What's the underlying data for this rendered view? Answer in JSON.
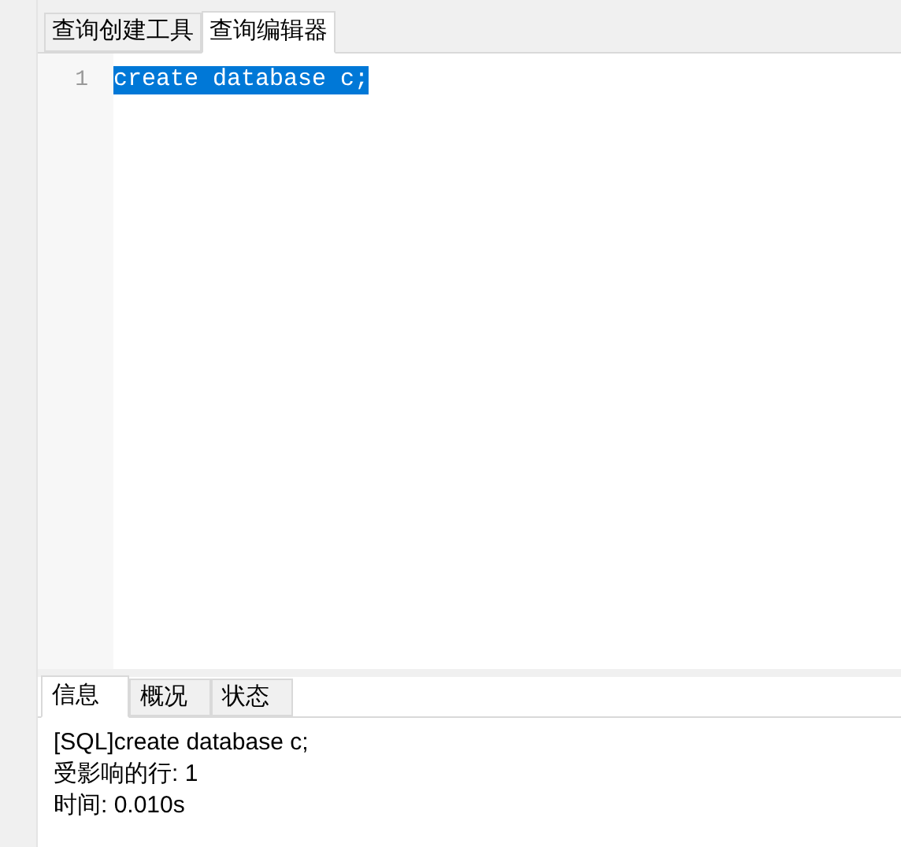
{
  "tabs": [
    {
      "label": "查询创建工具",
      "selected": false
    },
    {
      "label": "查询编辑器",
      "selected": true
    }
  ],
  "editor": {
    "lines": [
      {
        "number": "1",
        "code": "create database c;",
        "selected": true
      }
    ]
  },
  "result_tabs": [
    {
      "label": "信息",
      "selected": true
    },
    {
      "label": "概况",
      "selected": false
    },
    {
      "label": "状态",
      "selected": false
    }
  ],
  "messages": [
    "[SQL]create database c;",
    "受影响的行: 1",
    "时间: 0.010s"
  ]
}
